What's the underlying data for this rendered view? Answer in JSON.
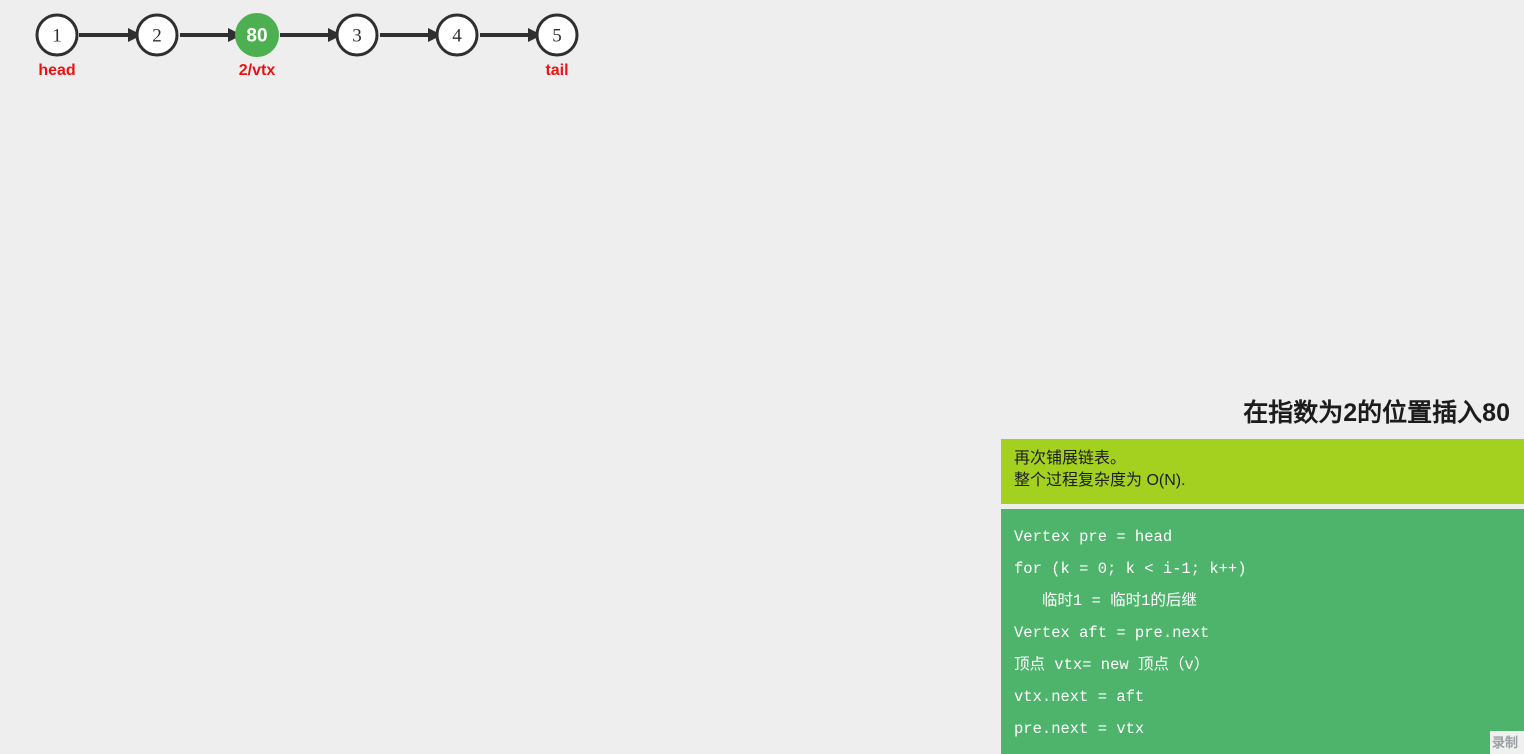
{
  "canvas": {
    "background_color": "#eeeeee"
  },
  "diagram": {
    "name": "singly-linked-list-after-insert",
    "node_fill_highlight": "#4caf50",
    "node_stroke": "#2f2f2f",
    "pointer_label_color": "#e81414",
    "nodes": [
      {
        "value": "1",
        "highlight": false,
        "pointer": "head"
      },
      {
        "value": "2",
        "highlight": false,
        "pointer": ""
      },
      {
        "value": "80",
        "highlight": true,
        "pointer": "2/vtx"
      },
      {
        "value": "3",
        "highlight": false,
        "pointer": ""
      },
      {
        "value": "4",
        "highlight": false,
        "pointer": ""
      },
      {
        "value": "5",
        "highlight": false,
        "pointer": "tail"
      }
    ]
  },
  "slide": {
    "title": "在指数为2的位置插入80",
    "note": {
      "background_color": "#a4d11f",
      "lines": [
        "再次铺展链表。",
        "整个过程复杂度为 O(N)."
      ]
    },
    "code": {
      "background_color": "#4eb46c",
      "text_color": "#ffffff",
      "lines": [
        "Vertex pre = head",
        "for (k = 0; k < i-1; k++)",
        "   临时1 = 临时1的后继",
        "Vertex aft = pre.next",
        "顶点 vtx= new 顶点（v）",
        "vtx.next = aft",
        "pre.next = vtx"
      ]
    }
  },
  "watermark": {
    "text": "录制"
  }
}
